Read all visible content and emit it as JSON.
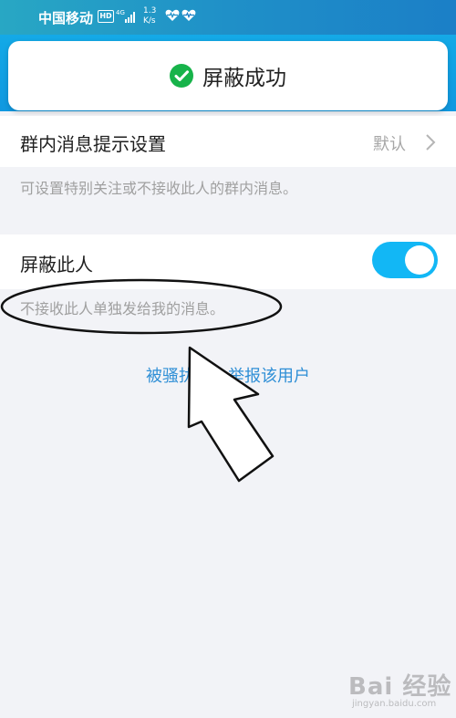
{
  "status_bar": {
    "carrier": "中国移动",
    "hd_badge": "HD",
    "network_type": "4G",
    "speed_value": "1.3",
    "speed_unit": "K/s"
  },
  "toast": {
    "text": "屏蔽成功",
    "icon": "check-circle-icon",
    "color": "#17b34a"
  },
  "group_notify": {
    "label": "群内消息提示设置",
    "value": "默认",
    "description": "可设置特别关注或不接收此人的群内消息。"
  },
  "block_user": {
    "label": "屏蔽此人",
    "enabled": true,
    "description": "不接收此人单独发给我的消息。"
  },
  "report": {
    "link_text": "被骚扰了？举报该用户"
  },
  "watermark": {
    "main": "Bai 经验",
    "sub": "jingyan.baidu.com"
  },
  "colors": {
    "accent": "#12b7f5",
    "link": "#2f8fd6",
    "background": "#f2f3f7"
  }
}
